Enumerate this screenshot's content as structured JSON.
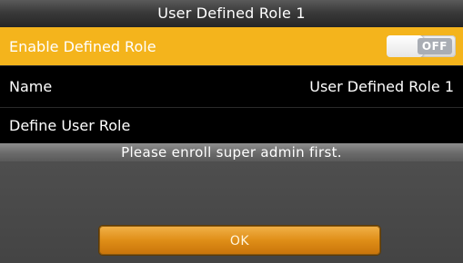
{
  "header": {
    "title": "User Defined Role 1"
  },
  "menu": {
    "enable_row": {
      "label": "Enable Defined Role",
      "toggle_state": "OFF",
      "highlight_color": "#f4b41c"
    },
    "name_row": {
      "label": "Name",
      "value": "User Defined Role 1"
    },
    "define_row": {
      "label": "Define User Role"
    }
  },
  "dialog": {
    "message": "Please enroll super admin first.",
    "ok_label": "OK",
    "button_color": "#df8e17"
  }
}
